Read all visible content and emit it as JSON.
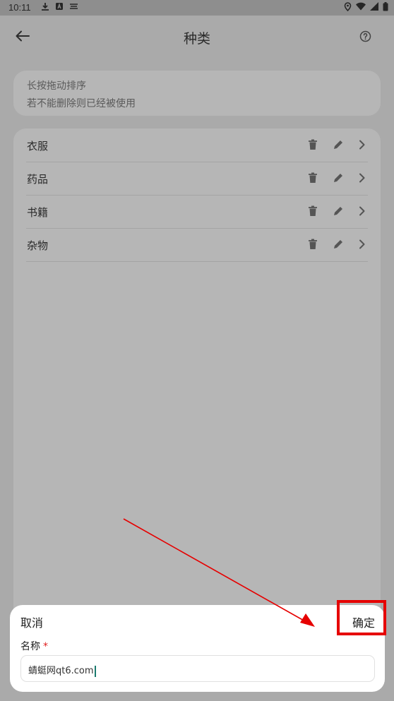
{
  "status_bar": {
    "time": "10:11",
    "icons_left": [
      "download-icon",
      "a-badge-icon",
      "subtitles-icon"
    ],
    "icons_right": [
      "location-icon",
      "wifi-icon",
      "signal-icon",
      "battery-icon"
    ]
  },
  "app_bar": {
    "title": "种类",
    "back_icon": "arrow-left-icon",
    "help_icon": "help-circle-icon"
  },
  "hint": {
    "line1": "长按拖动排序",
    "line2": "若不能删除则已经被使用"
  },
  "categories": [
    {
      "name": "衣服"
    },
    {
      "name": "药品"
    },
    {
      "name": "书籍"
    },
    {
      "name": "杂物"
    }
  ],
  "sheet": {
    "cancel_label": "取消",
    "confirm_label": "确定",
    "field_label": "名称",
    "required_mark": "*",
    "input_value": "蜻蜓网qt6.com"
  },
  "colors": {
    "annotation": "#e60000",
    "overlay_background": "#aaaaaa",
    "card_background": "#b6b6b6",
    "caret": "#1a7a6e"
  }
}
